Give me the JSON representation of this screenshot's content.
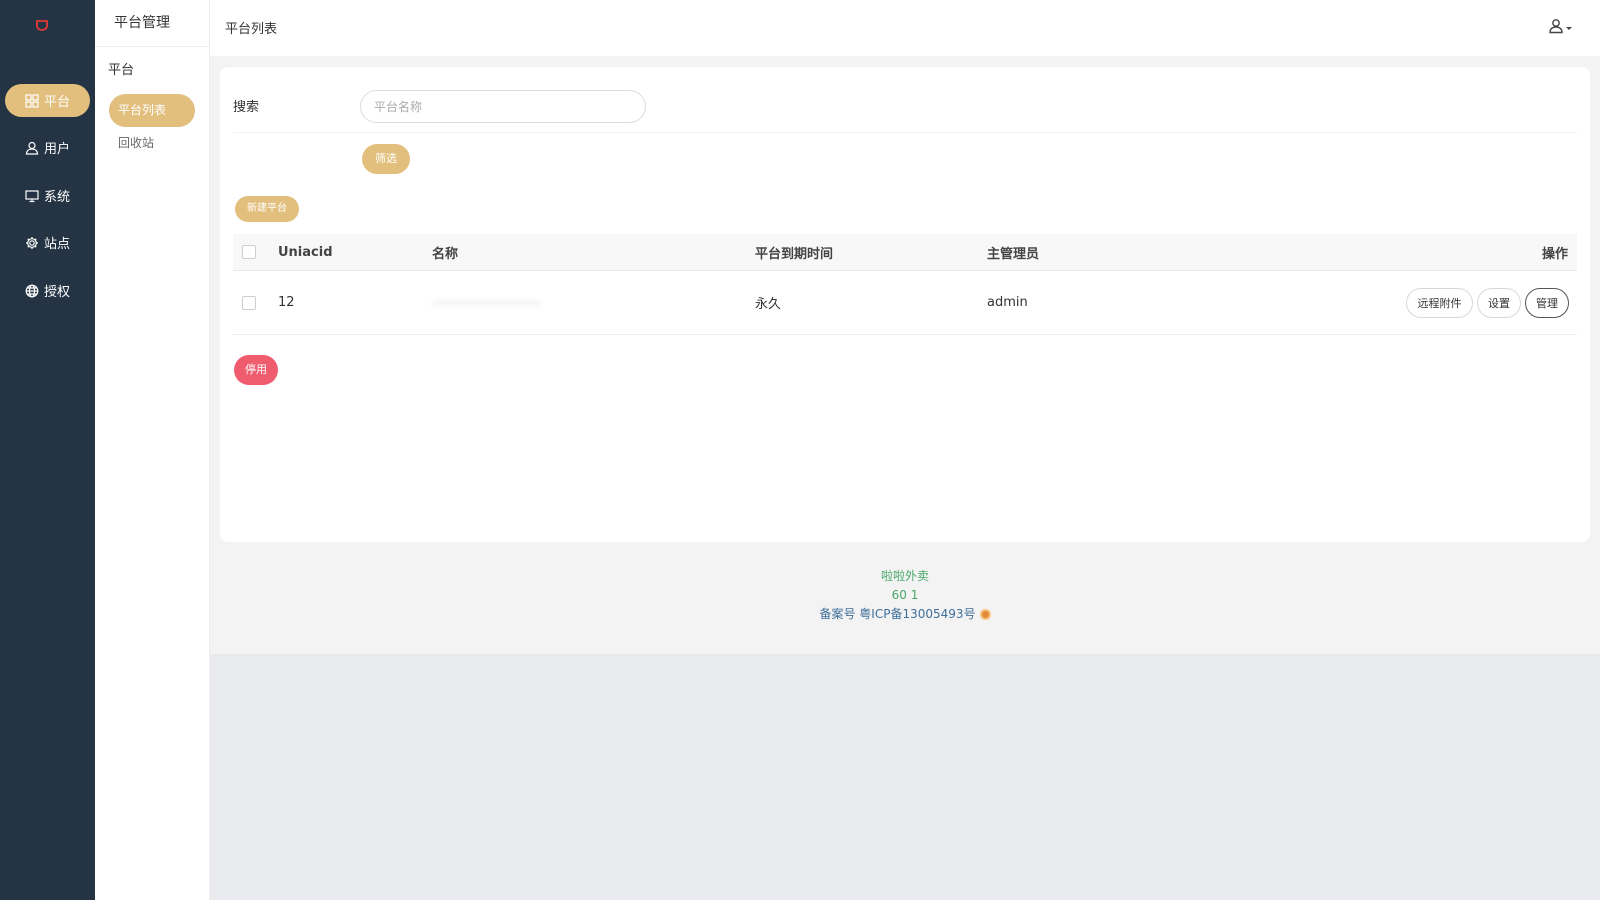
{
  "nav": {
    "items": [
      {
        "label": "平台",
        "icon": "grid-icon",
        "active": true
      },
      {
        "label": "用户",
        "icon": "user-icon",
        "active": false
      },
      {
        "label": "系统",
        "icon": "monitor-icon",
        "active": false
      },
      {
        "label": "站点",
        "icon": "gear-icon",
        "active": false
      },
      {
        "label": "授权",
        "icon": "globe-icon",
        "active": false
      }
    ]
  },
  "subnav": {
    "header": "平台管理",
    "group": "平台",
    "items": [
      {
        "label": "平台列表",
        "active": true
      },
      {
        "label": "回收站",
        "active": false
      }
    ]
  },
  "topbar": {
    "title": "平台列表"
  },
  "search": {
    "label": "搜索",
    "placeholder": "平台名称",
    "value": "",
    "filter_label": "筛选"
  },
  "actions": {
    "new_label": "新建平台",
    "disable_label": "停用"
  },
  "table": {
    "columns": [
      "Uniacid",
      "名称",
      "平台到期时间",
      "主管理员",
      "操作"
    ],
    "rows": [
      {
        "uniacid": "12",
        "name": "",
        "expire": "永久",
        "admin": "admin",
        "ops": [
          "远程附件",
          "设置",
          "管理"
        ]
      }
    ]
  },
  "footer": {
    "line1": "啦啦外卖",
    "line2": "60 1",
    "line3": "备案号 粤ICP备13005493号"
  },
  "colors": {
    "nav_bg": "#253444",
    "accent_gold": "#e2bf7d",
    "danger": "#ef5c6e",
    "footer_green": "#4aa86a",
    "footer_blue": "#3f6f9a"
  }
}
